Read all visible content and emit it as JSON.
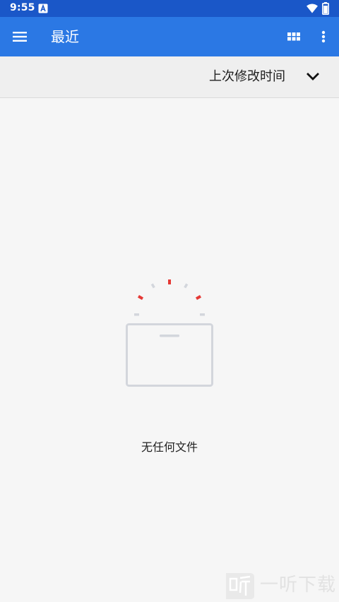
{
  "status_bar": {
    "time": "9:55",
    "notification_icon": "a-notification-icon",
    "wifi_icon": "wifi-icon",
    "battery_icon": "battery-icon",
    "background": "#1a57c8"
  },
  "app_bar": {
    "title": "最近",
    "menu_icon": "menu-icon",
    "grid_icon": "grid-view-icon",
    "more_icon": "more-vert-icon",
    "background": "#2b78e4"
  },
  "sort_bar": {
    "label": "上次修改时间",
    "chevron_icon": "chevron-down-icon"
  },
  "empty_state": {
    "message": "无任何文件",
    "illustration": "empty-box-icon",
    "accent_color": "#e53935",
    "box_color": "#d3d6dc"
  },
  "watermark": {
    "text": "一听下载"
  }
}
